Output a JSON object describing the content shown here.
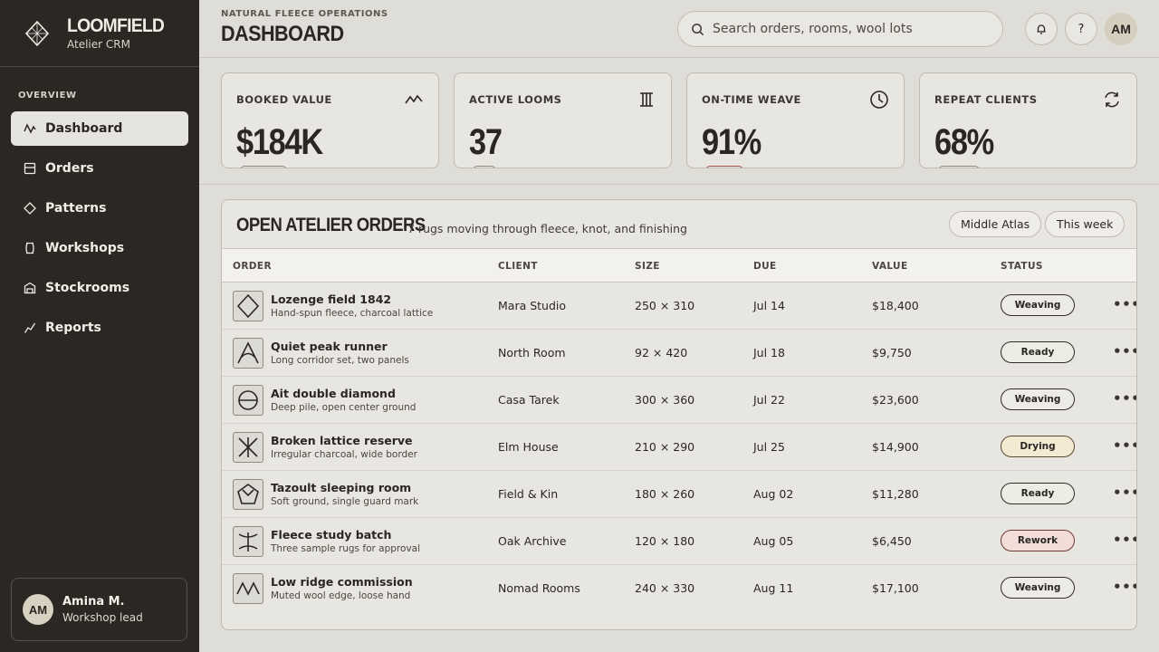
{
  "brand": {
    "name": "LOOMFIELD",
    "subtitle": "Atelier CRM"
  },
  "sidebar": {
    "section": "OVERVIEW",
    "items": [
      {
        "label": "Dashboard",
        "icon": "activity-icon",
        "active": true
      },
      {
        "label": "Orders",
        "icon": "orders-icon"
      },
      {
        "label": "Patterns",
        "icon": "diamond-icon"
      },
      {
        "label": "Workshops",
        "icon": "workshop-icon"
      },
      {
        "label": "Stockrooms",
        "icon": "stockroom-icon"
      },
      {
        "label": "Reports",
        "icon": "trend-icon"
      }
    ],
    "user": {
      "initials": "AM",
      "name": "Amina M.",
      "role": "Workshop lead"
    }
  },
  "header": {
    "eyebrow": "NATURAL FLEECE OPERATIONS",
    "title": "DASHBOARD",
    "search_placeholder": "Search orders, rooms, wool lots",
    "notification_icon": "bell-icon",
    "help_label": "?",
    "avatar_initials": "AM"
  },
  "kpis": [
    {
      "label": "BOOKED VALUE",
      "value": "$184K",
      "icon": "pulse-icon"
    },
    {
      "label": "ACTIVE LOOMS",
      "value": "37",
      "icon": "loom-icon"
    },
    {
      "label": "ON-TIME WEAVE",
      "value": "91%",
      "icon": "clock-icon"
    },
    {
      "label": "REPEAT CLIENTS",
      "value": "68%",
      "icon": "refresh-icon"
    }
  ],
  "orders": {
    "title": "OPEN ATELIER ORDERS",
    "subtitle": "7 rugs moving through fleece, knot, and finishing",
    "filters": [
      "Middle Atlas",
      "This week"
    ],
    "columns": [
      "ORDER",
      "CLIENT",
      "SIZE",
      "DUE",
      "VALUE",
      "STATUS"
    ],
    "rows": [
      {
        "name": "Lozenge field 1842",
        "desc": "Hand-spun fleece, charcoal lattice",
        "client": "Mara Studio",
        "size": "250 × 310",
        "due": "Jul 14",
        "value": "$18,400",
        "status": "Weaving",
        "motif": "lozenge-motif-icon"
      },
      {
        "name": "Quiet peak runner",
        "desc": "Long corridor set, two panels",
        "client": "North Room",
        "size": "92 × 420",
        "due": "Jul 18",
        "value": "$9,750",
        "status": "Ready",
        "motif": "peak-motif-icon"
      },
      {
        "name": "Ait double diamond",
        "desc": "Deep pile, open center ground",
        "client": "Casa Tarek",
        "size": "300 × 360",
        "due": "Jul 22",
        "value": "$23,600",
        "status": "Weaving",
        "motif": "double-diamond-motif-icon"
      },
      {
        "name": "Broken lattice reserve",
        "desc": "Irregular charcoal, wide border",
        "client": "Elm House",
        "size": "210 × 290",
        "due": "Jul 25",
        "value": "$14,900",
        "status": "Drying",
        "motif": "lattice-motif-icon"
      },
      {
        "name": "Tazoult sleeping room",
        "desc": "Soft ground, single guard mark",
        "client": "Field & Kin",
        "size": "180 × 260",
        "due": "Aug 02",
        "value": "$11,280",
        "status": "Ready",
        "motif": "pentagon-motif-icon"
      },
      {
        "name": "Fleece study batch",
        "desc": "Three sample rugs for approval",
        "client": "Oak Archive",
        "size": "120 × 180",
        "due": "Aug 05",
        "value": "$6,450",
        "status": "Rework",
        "motif": "spindle-motif-icon"
      },
      {
        "name": "Low ridge commission",
        "desc": "Muted wool edge, loose hand",
        "client": "Nomad Rooms",
        "size": "240 × 330",
        "due": "Aug 11",
        "value": "$17,100",
        "status": "Weaving",
        "motif": "ridge-motif-icon"
      }
    ],
    "more_label": "•••"
  },
  "colors": {
    "sidebar_bg": "#2b2824",
    "page_bg": "#deddd7",
    "card_bg": "#e8e6e1",
    "drying": "#f4e9d3",
    "rework": "#f2ddd9"
  }
}
